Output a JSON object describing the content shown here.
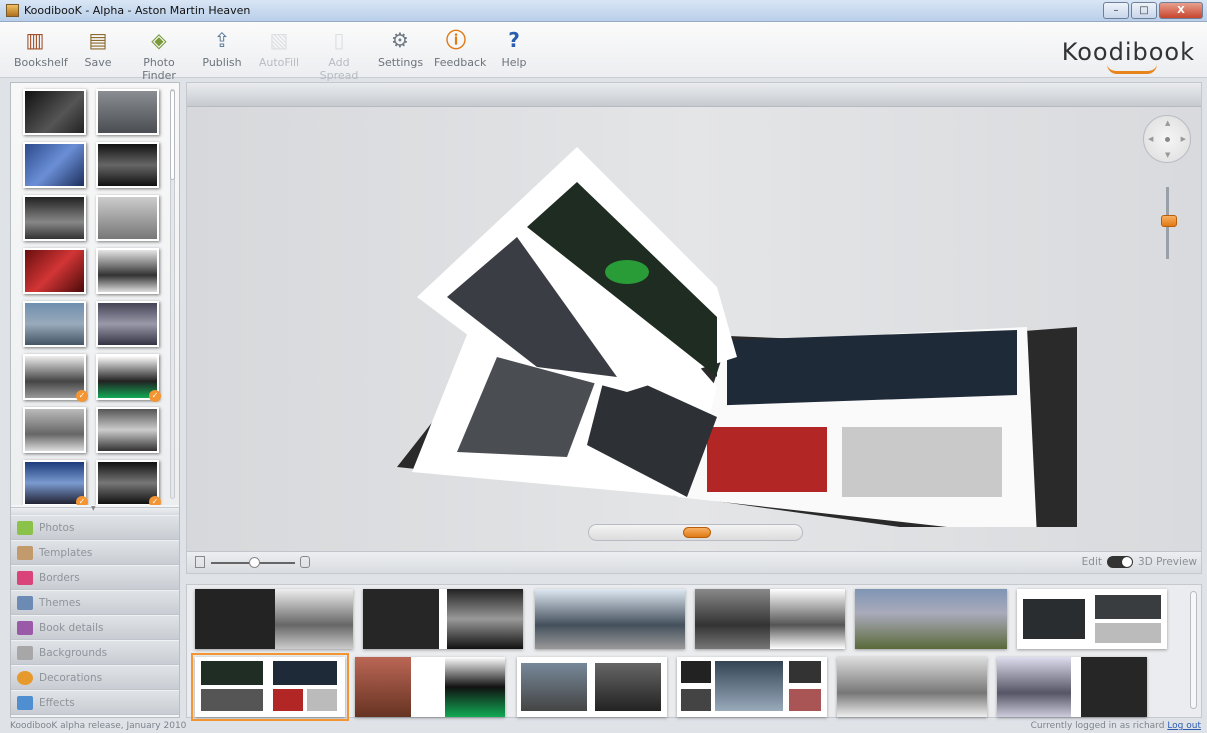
{
  "window": {
    "title": "KoodibooK - Alpha - Aston Martin Heaven",
    "buttons": {
      "minimize": "–",
      "maximize": "□",
      "close": "X"
    }
  },
  "toolbar": {
    "items": [
      {
        "label": "Bookshelf",
        "icon": "bookshelf-icon",
        "glyph": "📚",
        "enabled": true
      },
      {
        "label": "Save",
        "icon": "save-icon",
        "glyph": "💾",
        "enabled": true
      },
      {
        "label": "Photo Finder",
        "icon": "photo-finder-icon",
        "glyph": "📦",
        "enabled": true
      },
      {
        "label": "Publish",
        "icon": "publish-icon",
        "glyph": "📤",
        "enabled": true
      },
      {
        "label": "AutoFill",
        "icon": "autofill-icon",
        "glyph": "📑",
        "enabled": false
      },
      {
        "label": "Add Spread",
        "icon": "add-spread-icon",
        "glyph": "📄",
        "enabled": false
      },
      {
        "label": "Settings",
        "icon": "settings-icon",
        "glyph": "⚙",
        "enabled": true
      },
      {
        "label": "Feedback",
        "icon": "feedback-icon",
        "glyph": "!",
        "enabled": true
      },
      {
        "label": "Help",
        "icon": "help-icon",
        "glyph": "?",
        "enabled": true
      }
    ],
    "logo": "Koodibook"
  },
  "left_panel": {
    "nav": [
      {
        "label": "Photos",
        "icon": "photos-icon",
        "color": "#8bc34a"
      },
      {
        "label": "Templates",
        "icon": "templates-icon",
        "color": "#c29a6b"
      },
      {
        "label": "Borders",
        "icon": "borders-icon",
        "color": "#d9437a"
      },
      {
        "label": "Themes",
        "icon": "themes-icon",
        "color": "#6b8bb5"
      },
      {
        "label": "Book details",
        "icon": "book-details-icon",
        "color": "#9a5aa8"
      },
      {
        "label": "Backgrounds",
        "icon": "backgrounds-icon",
        "color": "#a7a7a7"
      },
      {
        "label": "Decorations",
        "icon": "decorations-icon",
        "color": "#e59a2b"
      },
      {
        "label": "Effects",
        "icon": "effects-icon",
        "color": "#4f8ed1"
      }
    ]
  },
  "canvas": {
    "edit_label": "Edit",
    "preview_label": "3D Preview"
  },
  "footer": {
    "release": "KoodibooK alpha release, January 2010",
    "login_status": "Currently logged in as richard",
    "logout": "Log out"
  },
  "colors": {
    "accent": "#f29532",
    "link": "#2a5db0"
  }
}
